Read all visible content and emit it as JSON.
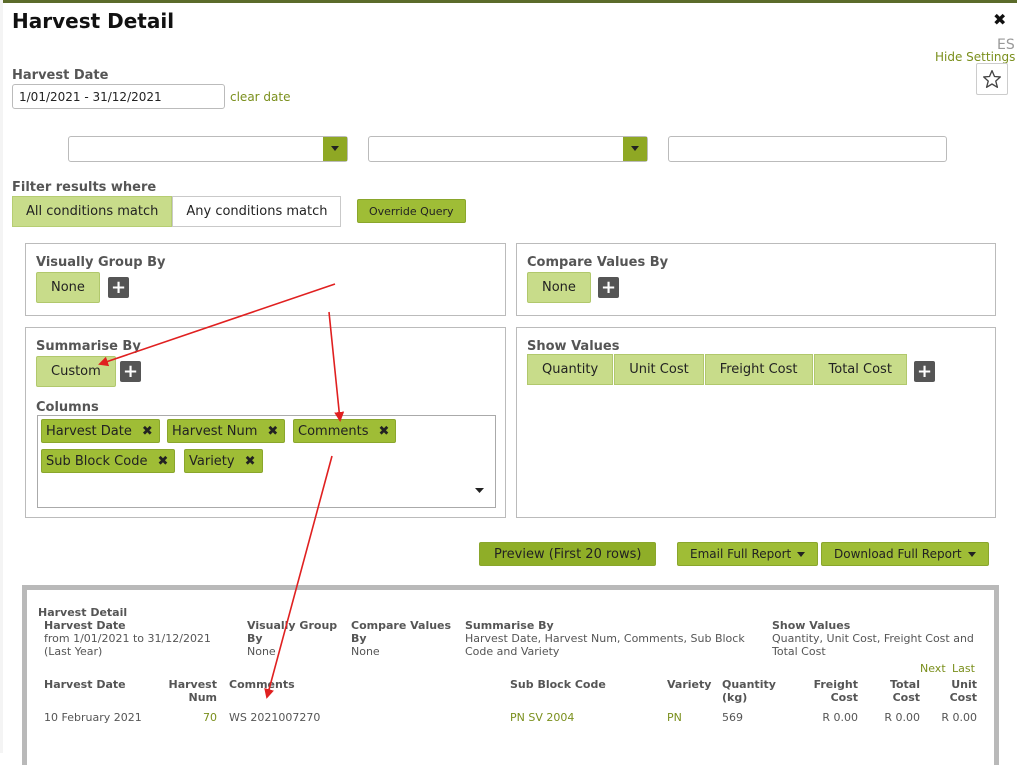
{
  "dialog": {
    "title": "Harvest Detail",
    "close_label": "✖",
    "es_label": "ES",
    "hide_settings": "Hide Settings"
  },
  "harvest_date": {
    "label": "Harvest Date",
    "value": "1/01/2021 - 31/12/2021",
    "clear_label": "clear date"
  },
  "filter": {
    "label": "Filter results where",
    "all_label": "All conditions match",
    "any_label": "Any conditions match",
    "override_label": "Override Query"
  },
  "group_by": {
    "title": "Visually Group By",
    "value": "None"
  },
  "compare_by": {
    "title": "Compare Values By",
    "value": "None"
  },
  "summarise_by": {
    "title": "Summarise By",
    "value": "Custom"
  },
  "columns": {
    "title": "Columns",
    "chips": [
      "Harvest Date",
      "Harvest Num",
      "Comments",
      "Sub Block Code",
      "Variety"
    ]
  },
  "show_values": {
    "title": "Show Values",
    "items": [
      "Quantity",
      "Unit Cost",
      "Freight Cost",
      "Total Cost"
    ]
  },
  "actions": {
    "preview": "Preview (First 20 rows)",
    "email": "Email Full Report",
    "download": "Download Full Report"
  },
  "preview": {
    "report_title": "Harvest Detail",
    "summary": {
      "harvest_date_label": "Harvest Date",
      "harvest_date_value": "from 1/01/2021 to 31/12/2021",
      "harvest_date_note": "(Last Year)",
      "group_label_1": "Visually Group",
      "group_label_2": "By",
      "group_value": "None",
      "compare_label_1": "Compare Values",
      "compare_label_2": "By",
      "compare_value": "None",
      "summarise_label": "Summarise By",
      "summarise_value_1": "Harvest Date, Harvest Num, Comments, Sub Block",
      "summarise_value_2": "Code and Variety",
      "show_label": "Show Values",
      "show_value_1": "Quantity, Unit Cost, Freight Cost and",
      "show_value_2": "Total Cost"
    },
    "pager": {
      "next": "Next",
      "last": "Last"
    },
    "headers": {
      "harvest_date": "Harvest Date",
      "harvest_num_1": "Harvest",
      "harvest_num_2": "Num",
      "comments": "Comments",
      "sub_block": "Sub Block Code",
      "variety": "Variety",
      "quantity_1": "Quantity",
      "quantity_2": "(kg)",
      "freight_1": "Freight",
      "freight_2": "Cost",
      "total_1": "Total",
      "total_2": "Cost",
      "unit_1": "Unit",
      "unit_2": "Cost"
    },
    "rows": [
      {
        "harvest_date": "10 February 2021",
        "harvest_num": "70",
        "comments": "WS 2021007270",
        "sub_block": "PN SV 2004",
        "variety": "PN",
        "quantity": "569",
        "freight": "R 0.00",
        "total": "R 0.00",
        "unit": "R 0.00"
      }
    ]
  },
  "colors": {
    "accent": "#9fbd36",
    "accent_light": "#c8dc8a",
    "link": "#7a8f1c",
    "arrow": "#e02020"
  }
}
